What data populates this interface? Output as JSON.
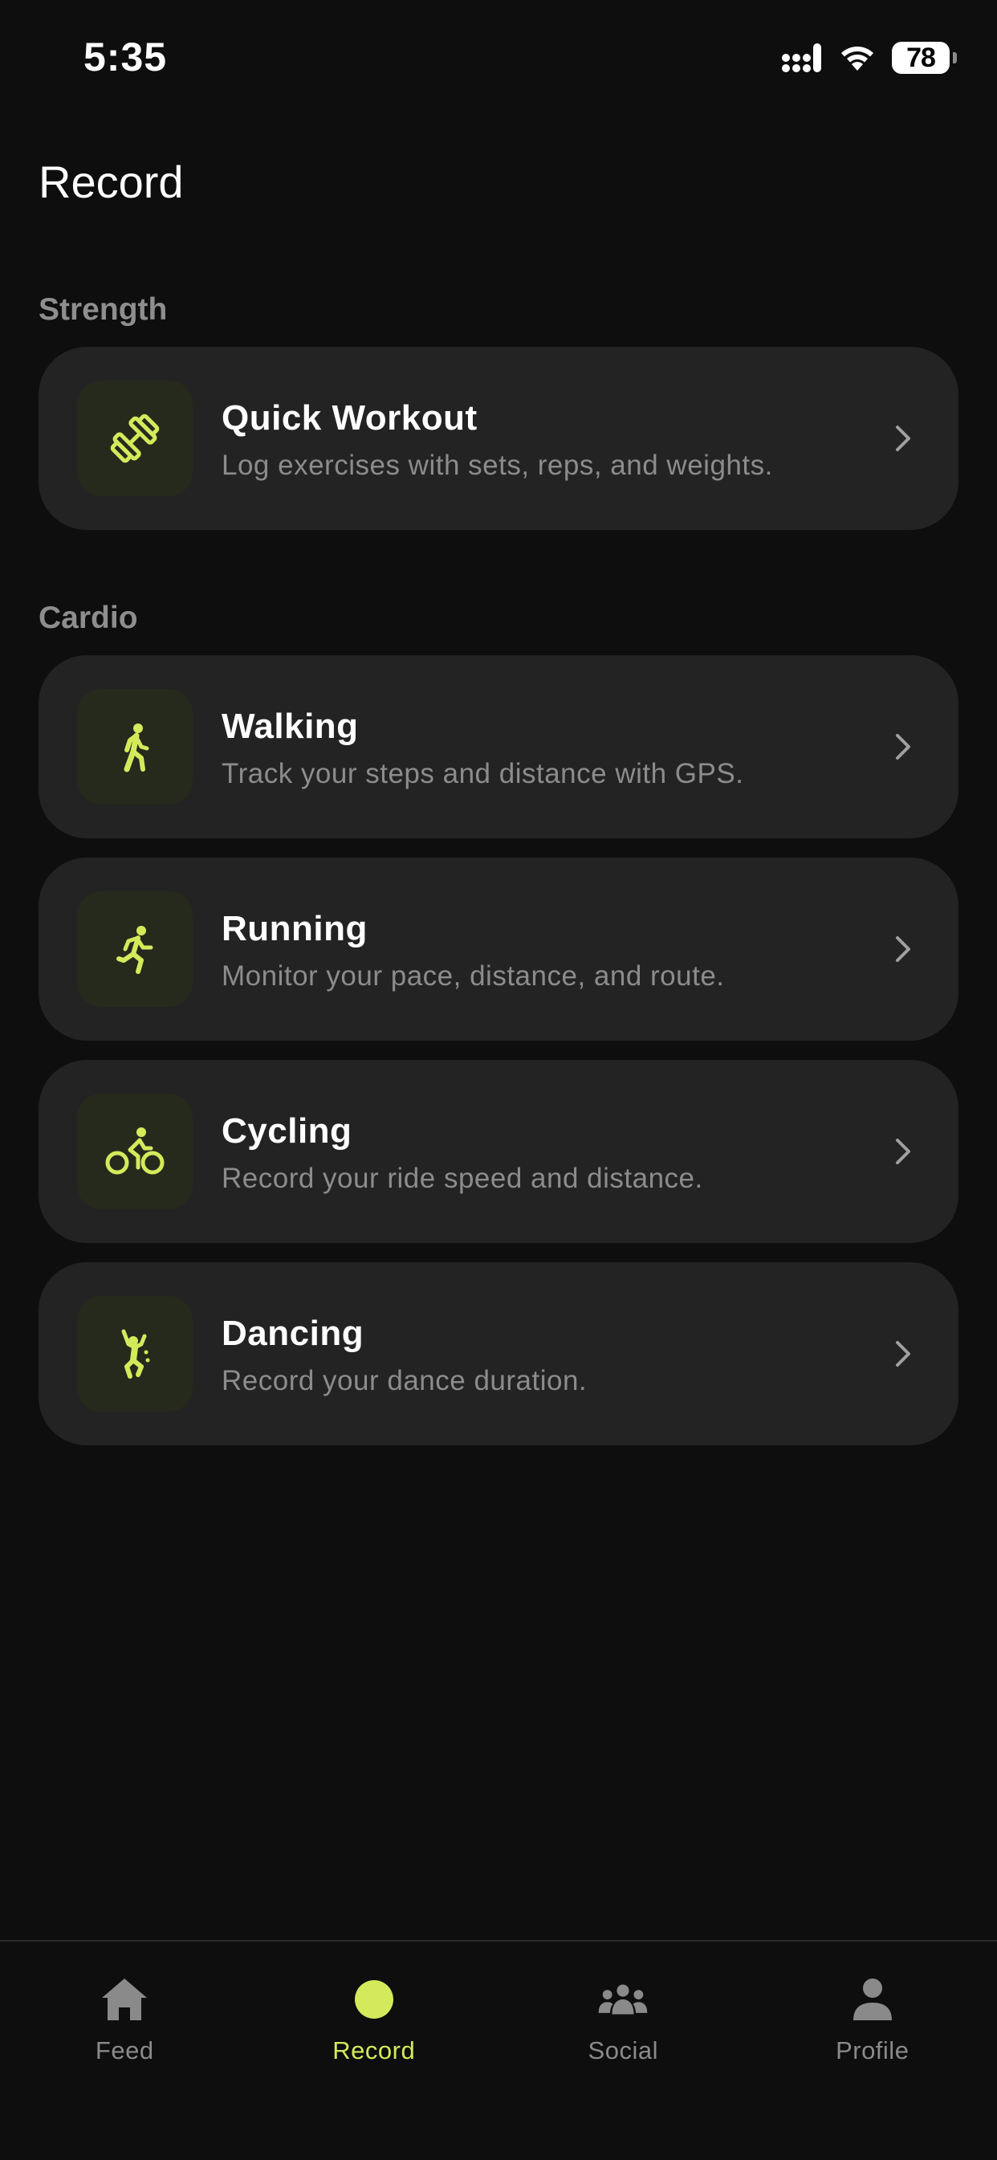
{
  "status_bar": {
    "time": "5:35",
    "battery": "78"
  },
  "page": {
    "title": "Record"
  },
  "sections": [
    {
      "label": "Strength",
      "items": [
        {
          "title": "Quick Workout",
          "description": "Log exercises with sets, reps, and weights.",
          "icon": "dumbbell-icon"
        }
      ]
    },
    {
      "label": "Cardio",
      "items": [
        {
          "title": "Walking",
          "description": "Track your steps and distance with GPS.",
          "icon": "walking-icon"
        },
        {
          "title": "Running",
          "description": "Monitor your pace, distance, and route.",
          "icon": "running-icon"
        },
        {
          "title": "Cycling",
          "description": "Record your ride speed and distance.",
          "icon": "cycling-icon"
        },
        {
          "title": "Dancing",
          "description": "Record your dance duration.",
          "icon": "dancing-icon"
        }
      ]
    }
  ],
  "tab_bar": {
    "active": "Record",
    "tabs": [
      {
        "label": "Feed",
        "icon": "home-icon"
      },
      {
        "label": "Record",
        "icon": "record-dot-icon"
      },
      {
        "label": "Social",
        "icon": "group-icon"
      },
      {
        "label": "Profile",
        "icon": "person-icon"
      }
    ]
  },
  "colors": {
    "background": "#0e0e0e",
    "card": "#232323",
    "accent": "#d4ea5b",
    "icon_tile": "#262a1c",
    "secondary_text": "#8c8c8c",
    "inactive_tab": "#8a8a8a"
  }
}
